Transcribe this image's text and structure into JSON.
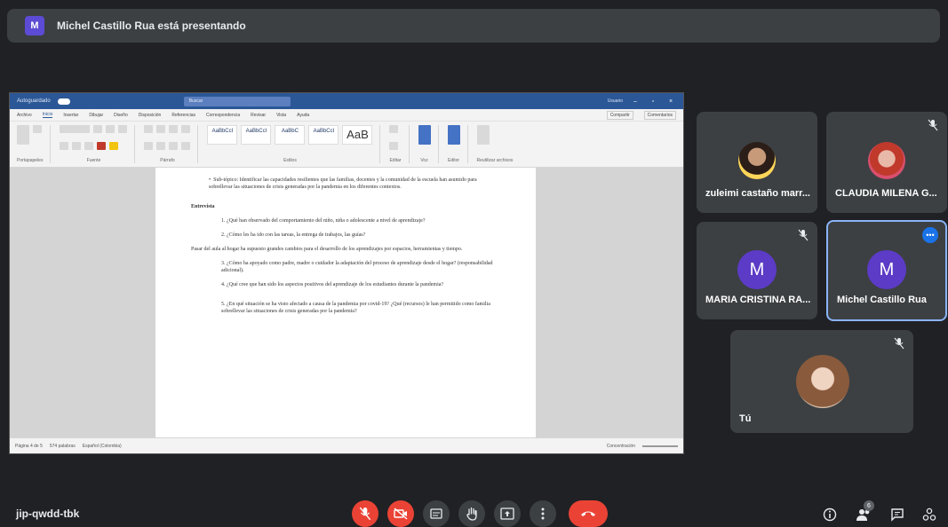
{
  "banner": {
    "avatar_letter": "M",
    "text": "Michel Castillo Rua está presentando"
  },
  "word": {
    "title_left": "Autoguardado",
    "search": "Buscar",
    "user": "Usuario",
    "menu": [
      "Archivo",
      "Inicio",
      "Insertar",
      "Dibujar",
      "Diseño",
      "Disposición",
      "Referencias",
      "Correspondencia",
      "Revisar",
      "Vista",
      "Ayuda"
    ],
    "share_label": "Compartir",
    "comments_label": "Comentarios",
    "ribbon_groups": [
      "Portapapeles",
      "Fuente",
      "Párrafo",
      "Estilos",
      "Editar",
      "Voz",
      "Editor",
      "Reutilizar archivos"
    ],
    "style_samples": [
      "AaBbCcI",
      "AaBbCcI",
      "AaBbC",
      "AaBbCcI",
      "AaB"
    ],
    "status_left": "Página 4 de 5",
    "status_words": "574 palabras",
    "status_lang": "Español (Colombia)",
    "status_focus": "Concentración"
  },
  "document": {
    "bullet_text": "Sub-tópico: Identificar las capacidades resilientes que las familias, docentes y la comunidad de la escuela han asumido para sobrellevar las situaciones de crisis generadas por la pandemia en los diferentes contextos.",
    "bullet_label": "Sub-tópico:",
    "section": "Entrevista",
    "q1": "1. ¿Qué han observado del comportamiento del niño, niña o adolescente a nivel de aprendizaje?",
    "q2": "2. ¿Cómo les ha ido con las tareas, la entrega de trabajos, las guías?",
    "para": "Pasar del aula al hogar ha supuesto grandes cambios para el desarrollo de los aprendizajes por espacios, herramientas y tiempo.",
    "q3": "3. ¿Cómo ha apoyado como padre, madre o cuidador la adaptación del proceso de aprendizaje desde el hogar? (responsabilidad adicional).",
    "q4": "4. ¿Qué cree que han sido los aspectos positivos del aprendizaje de los estudiantes durante la pandemia?",
    "q5": "5. ¿En qué situación se ha visto afectado a causa de la pandemia por covid-19? ¿Qué (recursos) le han permitido como familia sobrellevar las situaciones de crisis generadas por la pandemia?"
  },
  "participants": [
    {
      "name": "zuleimi castaño marr...",
      "kind": "photo"
    },
    {
      "name": "CLAUDIA MILENA G...",
      "kind": "photo"
    },
    {
      "name": "MARIA CRISTINA RA...",
      "kind": "letter",
      "letter": "M"
    },
    {
      "name": "Michel Castillo Rua",
      "kind": "letter",
      "letter": "M"
    },
    {
      "name": "Tú",
      "kind": "photo"
    }
  ],
  "bottom": {
    "meeting_code": "jip-qwdd-tbk",
    "participants_count": "6"
  },
  "colors": {
    "background": "#202124",
    "tile": "#3c4043",
    "accent_blue": "#1a73e8",
    "danger": "#ea4335",
    "avatar_purple": "#5c3bc7",
    "word_blue": "#2b5797"
  },
  "icons": [
    "mic-off-icon",
    "camera-off-icon",
    "captions-icon",
    "raise-hand-icon",
    "present-icon",
    "more-options-icon",
    "hang-up-icon",
    "info-icon",
    "people-icon",
    "chat-icon",
    "activities-icon"
  ]
}
